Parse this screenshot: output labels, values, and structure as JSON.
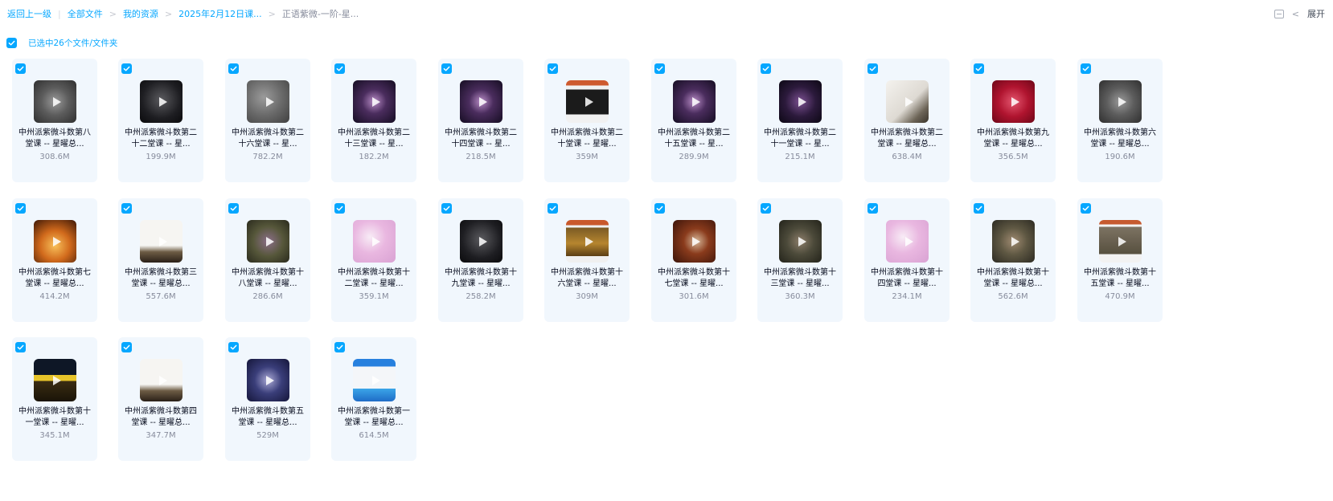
{
  "breadcrumb": {
    "back": "返回上一级",
    "items": [
      "全部文件",
      "我的资源",
      "2025年2月12日课...",
      "正语紫微-一阶-星..."
    ]
  },
  "toolbar": {
    "expand_label": "展开"
  },
  "selection": {
    "label": "已选中26个文件/文件夹"
  },
  "accent_color": "#06a7ff",
  "files": [
    {
      "name": "中州派紫微斗数第八堂课 -- 星曜总...",
      "size": "308.6M",
      "thumb": "scroll-dark"
    },
    {
      "name": "中州派紫微斗数第二十二堂课 -- 星...",
      "size": "199.9M",
      "thumb": "dark"
    },
    {
      "name": "中州派紫微斗数第二十六堂课 -- 星...",
      "size": "782.2M",
      "thumb": "gray"
    },
    {
      "name": "中州派紫微斗数第二十三堂课 -- 星...",
      "size": "182.2M",
      "thumb": "galaxy"
    },
    {
      "name": "中州派紫微斗数第二十四堂课 -- 星...",
      "size": "218.5M",
      "thumb": "galaxy"
    },
    {
      "name": "中州派紫微斗数第二十堂课 -- 星曜...",
      "size": "359M",
      "thumb": "slide"
    },
    {
      "name": "中州派紫微斗数第二十五堂课 -- 星...",
      "size": "289.9M",
      "thumb": "galaxy"
    },
    {
      "name": "中州派紫微斗数第二十一堂课 -- 星...",
      "size": "215.1M",
      "thumb": "galaxy-dark"
    },
    {
      "name": "中州派紫微斗数第二堂课 -- 星曜总...",
      "size": "638.4M",
      "thumb": "ink"
    },
    {
      "name": "中州派紫微斗数第九堂课 -- 星曜总...",
      "size": "356.5M",
      "thumb": "red"
    },
    {
      "name": "中州派紫微斗数第六堂课 -- 星曜总...",
      "size": "190.6M",
      "thumb": "scroll-dark"
    },
    {
      "name": "中州派紫微斗数第七堂课 -- 星曜总...",
      "size": "414.2M",
      "thumb": "orange"
    },
    {
      "name": "中州派紫微斗数第三堂课 -- 星曜总...",
      "size": "557.6M",
      "thumb": "table"
    },
    {
      "name": "中州派紫微斗数第十八堂课 -- 星曜...",
      "size": "286.6M",
      "thumb": "olive"
    },
    {
      "name": "中州派紫微斗数第十二堂课 -- 星曜...",
      "size": "359.1M",
      "thumb": "pink"
    },
    {
      "name": "中州派紫微斗数第十九堂课 -- 星曜...",
      "size": "258.2M",
      "thumb": "dark"
    },
    {
      "name": "中州派紫微斗数第十六堂课 -- 星曜...",
      "size": "309M",
      "thumb": "slide-brown"
    },
    {
      "name": "中州派紫微斗数第十七堂课 -- 星曜...",
      "size": "301.6M",
      "thumb": "horse"
    },
    {
      "name": "中州派紫微斗数第十三堂课 -- 星曜...",
      "size": "360.3M",
      "thumb": "olive-dark"
    },
    {
      "name": "中州派紫微斗数第十四堂课 -- 星曜...",
      "size": "234.1M",
      "thumb": "pink"
    },
    {
      "name": "中州派紫微斗数第十堂课 -- 星曜总...",
      "size": "562.6M",
      "thumb": "tree"
    },
    {
      "name": "中州派紫微斗数第十五堂课 -- 星曜...",
      "size": "470.9M",
      "thumb": "slide-gray"
    },
    {
      "name": "中州派紫微斗数第十一堂课 -- 星曜...",
      "size": "345.1M",
      "thumb": "yellow-band"
    },
    {
      "name": "中州派紫微斗数第四堂课 -- 星曜总...",
      "size": "347.7M",
      "thumb": "table"
    },
    {
      "name": "中州派紫微斗数第五堂课 -- 星曜总...",
      "size": "529M",
      "thumb": "blue-night"
    },
    {
      "name": "中州派紫微斗数第一堂课 -- 星曜总...",
      "size": "614.5M",
      "thumb": "desktop"
    }
  ]
}
